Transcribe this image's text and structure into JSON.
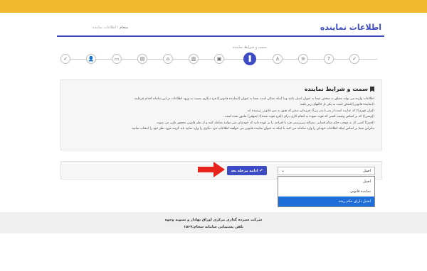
{
  "header": {
    "title": "اطلاعات نماینده",
    "breadcrumb_home": "سجام",
    "breadcrumb_current": "اطلاعات نماینده"
  },
  "stepper": {
    "active_label": "سمت و شرایط نماینده",
    "active_index": 5,
    "icons": [
      "check-icon",
      "user-icon",
      "user-icon",
      "bank-icon",
      "building-icon",
      "briefcase-icon",
      "card-icon",
      "card-icon",
      "bookmark-icon",
      "person-icon",
      "question-icon",
      "check-icon"
    ]
  },
  "info": {
    "title": "سمت و شرایط نماینده",
    "lines": [
      "اطلاعات وارده می تواند متعلق به شخص شما به عنوان اصیل باشد و یا اینکه ممکن است شما به عنوان ((نماینده قانونی)) فرد دیگری نسبت به ورود اطلاعات در این سامانه اقدام فرمایید.",
      "((نماینده قانونی))ممکن است به یکی از حالتهای زیر باشد:",
      "((ولی قهری)) که عبارت است از پدر یا پدر بزرگ فرزندان صغیر که هنوز به سن قانونی نرسیده اند.",
      "((وصی)) که بر اساس وصیت کسی که فوت نموده به انجام کاری برای ((فرد فوت شده)) (متوفی) مامور شده است .",
      "((قیم)) کسی که به موجب حکم مقام قضایی ذیصلاح سرپرستی فرد یا افرادی را بر عهده دارد که خودشان نمی توانند معامله کنند و از نظر قانونی محجور تلقی می شوند.",
      "بنابراین شما بر اساس اینکه اطلاعات خودتان را وارد سامانه می کنید یا اینکه به عنوان نماینده قانونی می خواهید اطلاعات فرد دیگری را وارد نمایید باید گزینه مورد نظر خود را انتخاب نمایید."
    ]
  },
  "actions": {
    "continue_label": "ادامه مرحله بعد",
    "select_value": "اصیل",
    "options": [
      "اصیل",
      "نماینده قانونی",
      "اصیل دارای حکم رشد"
    ],
    "highlighted_option_index": 2
  },
  "footer": {
    "line1": "شرکت سپرده گذاری مرکزی اوراق بهادار و تسویه وجوه",
    "line2": "تلفن پشتیبانی سامانه سجام:۱۵۶۹"
  },
  "colors": {
    "accent": "#3d4cc4",
    "topbar": "#f1b72f",
    "arrow": "#e8231c",
    "highlight": "#1e6fd9"
  }
}
